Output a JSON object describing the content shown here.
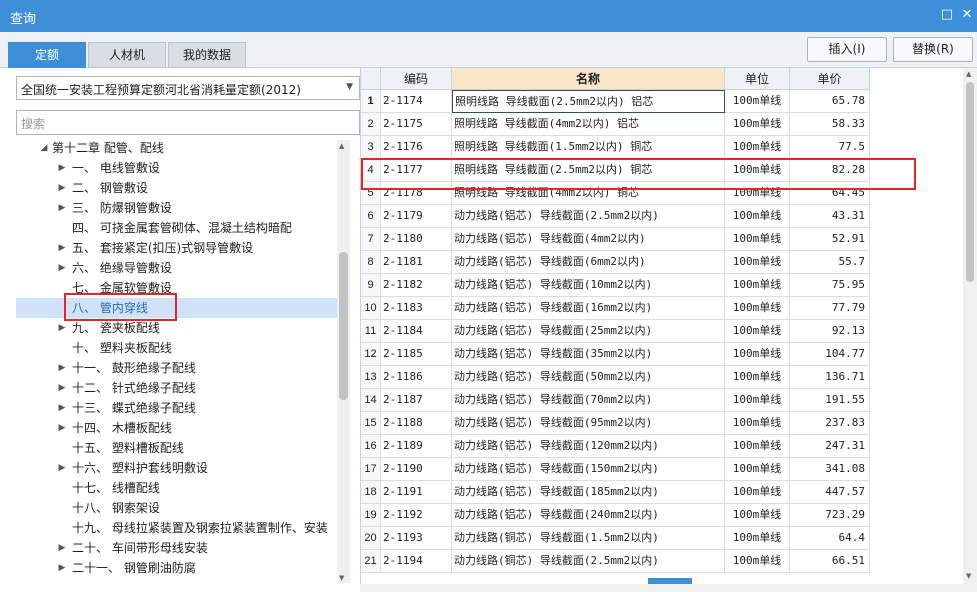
{
  "window": {
    "title": "查询"
  },
  "tabs": [
    {
      "label": "定额",
      "active": true
    },
    {
      "label": "人材机",
      "active": false
    },
    {
      "label": "我的数据",
      "active": false
    }
  ],
  "buttons": {
    "insert": "插入(I)",
    "replace": "替换(R)"
  },
  "library": {
    "selected": "全国统一安装工程预算定额河北省消耗量定额(2012)"
  },
  "search": {
    "placeholder": "搜索"
  },
  "tree": [
    {
      "label": "第十二章 配管、配线",
      "level": 0,
      "toggle": "expanded"
    },
    {
      "label": "一、 电线管敷设",
      "level": 1,
      "toggle": "collapsed"
    },
    {
      "label": "二、 钢管敷设",
      "level": 1,
      "toggle": "collapsed"
    },
    {
      "label": "三、 防爆钢管敷设",
      "level": 1,
      "toggle": "collapsed"
    },
    {
      "label": "四、 可挠金属套管砌体、混凝土结构暗配",
      "level": 1,
      "toggle": "none"
    },
    {
      "label": "五、 套接紧定(扣压)式钢导管敷设",
      "level": 1,
      "toggle": "collapsed"
    },
    {
      "label": "六、 绝缘导管敷设",
      "level": 1,
      "toggle": "collapsed"
    },
    {
      "label": "七、 金属软管敷设",
      "level": 1,
      "toggle": "none"
    },
    {
      "label": "八、 管内穿线",
      "level": 1,
      "toggle": "none",
      "selected": true
    },
    {
      "label": "九、 瓷夹板配线",
      "level": 1,
      "toggle": "collapsed"
    },
    {
      "label": "十、 塑料夹板配线",
      "level": 1,
      "toggle": "none"
    },
    {
      "label": "十一、 鼓形绝缘子配线",
      "level": 1,
      "toggle": "collapsed"
    },
    {
      "label": "十二、 针式绝缘子配线",
      "level": 1,
      "toggle": "collapsed"
    },
    {
      "label": "十三、 蝶式绝缘子配线",
      "level": 1,
      "toggle": "collapsed"
    },
    {
      "label": "十四、 木槽板配线",
      "level": 1,
      "toggle": "collapsed"
    },
    {
      "label": "十五、 塑料槽板配线",
      "level": 1,
      "toggle": "none"
    },
    {
      "label": "十六、 塑料护套线明敷设",
      "level": 1,
      "toggle": "collapsed"
    },
    {
      "label": "十七、 线槽配线",
      "level": 1,
      "toggle": "none"
    },
    {
      "label": "十八、 钢索架设",
      "level": 1,
      "toggle": "none"
    },
    {
      "label": "十九、 母线拉紧装置及钢索拉紧装置制作、安装",
      "level": 1,
      "toggle": "none"
    },
    {
      "label": "二十、 车间带形母线安装",
      "level": 1,
      "toggle": "collapsed"
    },
    {
      "label": "二十一、 钢管刷油防腐",
      "level": 1,
      "toggle": "collapsed"
    }
  ],
  "grid": {
    "headers": {
      "code": "编码",
      "name": "名称",
      "unit": "单位",
      "price": "单价"
    },
    "rows": [
      {
        "no": "1",
        "code": "2-1174",
        "name": "照明线路 导线截面(2.5mm2以内) 铝芯",
        "unit": "100m单线",
        "price": "65.78"
      },
      {
        "no": "2",
        "code": "2-1175",
        "name": "照明线路 导线截面(4mm2以内) 铝芯",
        "unit": "100m单线",
        "price": "58.33"
      },
      {
        "no": "3",
        "code": "2-1176",
        "name": "照明线路 导线截面(1.5mm2以内) 铜芯",
        "unit": "100m单线",
        "price": "77.5"
      },
      {
        "no": "4",
        "code": "2-1177",
        "name": "照明线路 导线截面(2.5mm2以内) 铜芯",
        "unit": "100m单线",
        "price": "82.28"
      },
      {
        "no": "5",
        "code": "2-1178",
        "name": "照明线路 导线截面(4mm2以内) 铜芯",
        "unit": "100m单线",
        "price": "64.45"
      },
      {
        "no": "6",
        "code": "2-1179",
        "name": "动力线路(铝芯) 导线截面(2.5mm2以内)",
        "unit": "100m单线",
        "price": "43.31"
      },
      {
        "no": "7",
        "code": "2-1180",
        "name": "动力线路(铝芯) 导线截面(4mm2以内)",
        "unit": "100m单线",
        "price": "52.91"
      },
      {
        "no": "8",
        "code": "2-1181",
        "name": "动力线路(铝芯) 导线截面(6mm2以内)",
        "unit": "100m单线",
        "price": "55.7"
      },
      {
        "no": "9",
        "code": "2-1182",
        "name": "动力线路(铝芯) 导线截面(10mm2以内)",
        "unit": "100m单线",
        "price": "75.95"
      },
      {
        "no": "10",
        "code": "2-1183",
        "name": "动力线路(铝芯) 导线截面(16mm2以内)",
        "unit": "100m单线",
        "price": "77.79"
      },
      {
        "no": "11",
        "code": "2-1184",
        "name": "动力线路(铝芯) 导线截面(25mm2以内)",
        "unit": "100m单线",
        "price": "92.13"
      },
      {
        "no": "12",
        "code": "2-1185",
        "name": "动力线路(铝芯) 导线截面(35mm2以内)",
        "unit": "100m单线",
        "price": "104.77"
      },
      {
        "no": "13",
        "code": "2-1186",
        "name": "动力线路(铝芯) 导线截面(50mm2以内)",
        "unit": "100m单线",
        "price": "136.71"
      },
      {
        "no": "14",
        "code": "2-1187",
        "name": "动力线路(铝芯) 导线截面(70mm2以内)",
        "unit": "100m单线",
        "price": "191.55"
      },
      {
        "no": "15",
        "code": "2-1188",
        "name": "动力线路(铝芯) 导线截面(95mm2以内)",
        "unit": "100m单线",
        "price": "237.83"
      },
      {
        "no": "16",
        "code": "2-1189",
        "name": "动力线路(铝芯) 导线截面(120mm2以内)",
        "unit": "100m单线",
        "price": "247.31"
      },
      {
        "no": "17",
        "code": "2-1190",
        "name": "动力线路(铝芯) 导线截面(150mm2以内)",
        "unit": "100m单线",
        "price": "341.08"
      },
      {
        "no": "18",
        "code": "2-1191",
        "name": "动力线路(铝芯) 导线截面(185mm2以内)",
        "unit": "100m单线",
        "price": "447.57"
      },
      {
        "no": "19",
        "code": "2-1192",
        "name": "动力线路(铝芯) 导线截面(240mm2以内)",
        "unit": "100m单线",
        "price": "723.29"
      },
      {
        "no": "20",
        "code": "2-1193",
        "name": "动力线路(铜芯) 导线截面(1.5mm2以内)",
        "unit": "100m单线",
        "price": "64.4"
      },
      {
        "no": "21",
        "code": "2-1194",
        "name": "动力线路(铜芯) 导线截面(2.5mm2以内)",
        "unit": "100m单线",
        "price": "66.51"
      }
    ]
  },
  "colors": {
    "accent": "#3d8fd8",
    "highlight": "#e8232a",
    "header_name": "#fbe7c8",
    "selection": "#cfe2f7"
  }
}
